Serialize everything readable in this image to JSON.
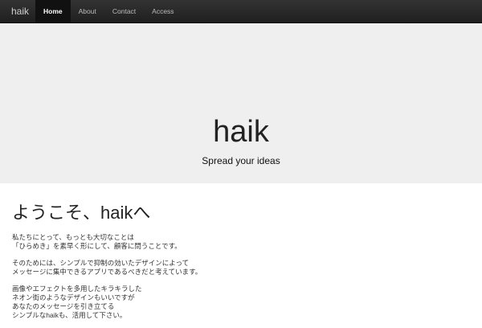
{
  "navbar": {
    "brand": "haik",
    "items": [
      {
        "label": "Home",
        "active": true
      },
      {
        "label": "About",
        "active": false
      },
      {
        "label": "Contact",
        "active": false
      },
      {
        "label": "Access",
        "active": false
      }
    ],
    "background": "#222222"
  },
  "hero": {
    "title": "haik",
    "tagline": "Spread your ideas",
    "background": "#efefef"
  },
  "content": {
    "heading": "ようこそ、haikへ",
    "paragraphs": [
      [
        "私たちにとって、もっとも大切なことは",
        "「ひらめき」を素早く形にして、顧客に問うことです。"
      ],
      [
        "そのためには、シンプルで抑制の効いたデザインによって",
        "メッセージに集中できるアプリであるべきだと考えています。"
      ],
      [
        "画像やエフェクトを多用したキラキラした",
        "ネオン街のようなデザインもいいですが",
        "あなたのメッセージを引き立てる",
        "シンプルなhaikも、活用して下さい。"
      ]
    ]
  }
}
